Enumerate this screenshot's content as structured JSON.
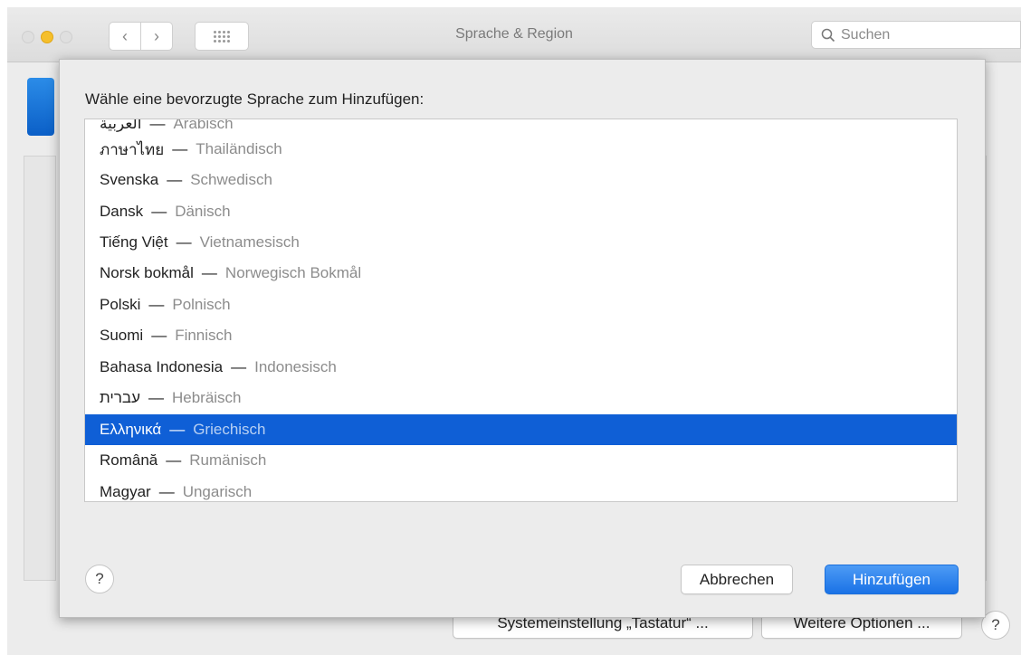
{
  "window": {
    "title": "Sprache & Region",
    "search_placeholder": "Suchen"
  },
  "background": {
    "keyboard_button": "Systemeinstellung „Tastatur“ ...",
    "more_options_button": "Weitere Optionen ...",
    "help": "?"
  },
  "sheet": {
    "prompt": "Wähle eine bevorzugte Sprache zum Hinzufügen:",
    "languages": [
      {
        "native": "العربية",
        "translation": "Arabisch"
      },
      {
        "native": "ภาษาไทย",
        "translation": "Thailändisch"
      },
      {
        "native": "Svenska",
        "translation": "Schwedisch"
      },
      {
        "native": "Dansk",
        "translation": "Dänisch"
      },
      {
        "native": "Tiếng Việt",
        "translation": "Vietnamesisch"
      },
      {
        "native": "Norsk bokmål",
        "translation": "Norwegisch Bokmål"
      },
      {
        "native": "Polski",
        "translation": "Polnisch"
      },
      {
        "native": "Suomi",
        "translation": "Finnisch"
      },
      {
        "native": "Bahasa Indonesia",
        "translation": "Indonesisch"
      },
      {
        "native": "עברית",
        "translation": "Hebräisch"
      },
      {
        "native": "Ελληνικά",
        "translation": "Griechisch"
      },
      {
        "native": "Română",
        "translation": "Rumänisch"
      },
      {
        "native": "Magyar",
        "translation": "Ungarisch"
      }
    ],
    "separator": "—",
    "selected_language": "Ελληνικά",
    "cancel_label": "Abbrechen",
    "add_label": "Hinzufügen",
    "help": "?"
  },
  "colors": {
    "selection": "#0f5fd6",
    "primary_button": "#1a72e6",
    "minimize_light": "#f5bf2b"
  }
}
